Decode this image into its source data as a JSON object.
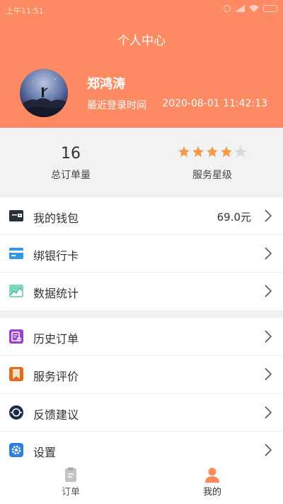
{
  "status_bar": {
    "time": "上午11:51"
  },
  "header": {
    "title": "个人中心",
    "user_name": "郑鸿涛",
    "login_label": "最近登录时间",
    "login_time": "2020-08-01 11:42:13"
  },
  "stats": {
    "orders_value": "16",
    "orders_label": "总订单量",
    "rating_stars": 4,
    "rating_max": 5,
    "rating_label": "服务星级"
  },
  "menu_group_1": [
    {
      "label": "我的钱包",
      "value": "69.0元",
      "icon": "wallet-icon"
    },
    {
      "label": "绑银行卡",
      "icon": "bank-card-icon"
    },
    {
      "label": "数据统计",
      "icon": "statistics-icon"
    }
  ],
  "menu_group_2": [
    {
      "label": "历史订单",
      "icon": "history-order-icon"
    },
    {
      "label": "服务评价",
      "icon": "review-icon"
    }
  ],
  "menu_group_3": [
    {
      "label": "反馈建议",
      "icon": "feedback-icon"
    },
    {
      "label": "设置",
      "icon": "settings-icon"
    }
  ],
  "tabbar": {
    "tabs": [
      {
        "label": "订单",
        "icon": "order-tab-icon",
        "active": false
      },
      {
        "label": "我的",
        "icon": "profile-tab-icon",
        "active": true
      }
    ]
  },
  "colors": {
    "header_bg": "#fd8a63",
    "accent": "#fa8c5c",
    "star_active": "#f59a47",
    "star_inactive": "#d8d8d8",
    "tab_inactive": "#b7b7b7"
  }
}
